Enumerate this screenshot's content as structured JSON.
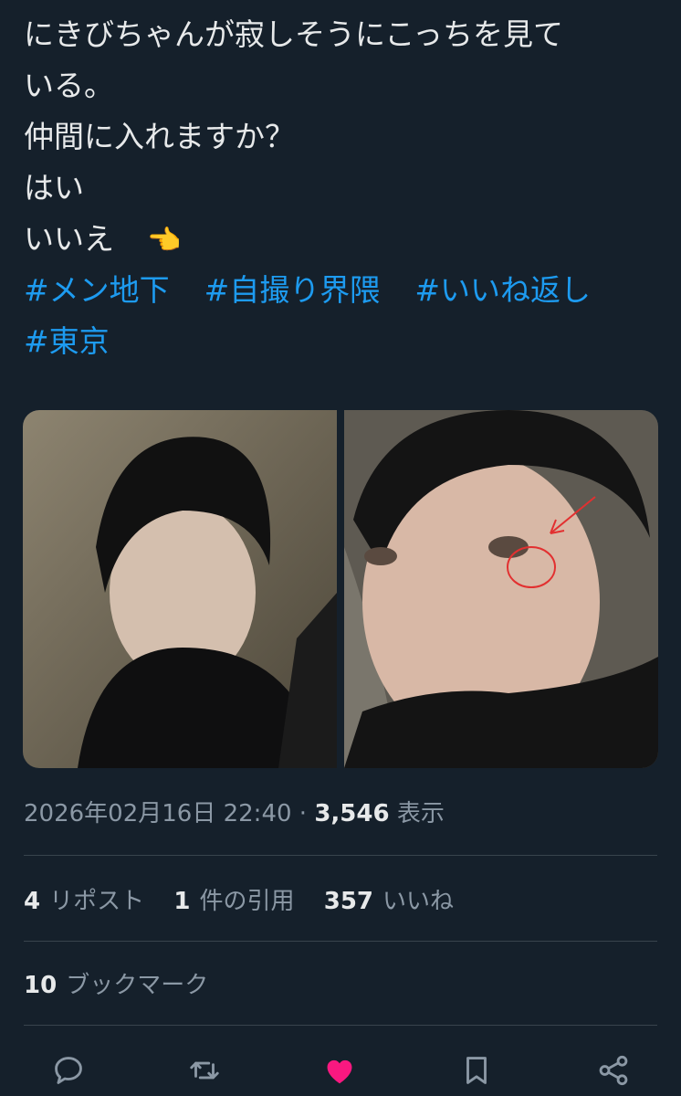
{
  "tweet": {
    "lines": [
      "にきびちゃんが寂しそうにこっちを見て",
      "いる。",
      "仲間に入れますか？",
      "はい",
      "いいえ"
    ],
    "emoji": "👈",
    "hashtags": [
      "#メン地下",
      "#自撮り界隈",
      "#いいね返し",
      "#東京"
    ]
  },
  "meta": {
    "datetime": "2026年02月16日 22:40",
    "separator": "·",
    "views": "3,546",
    "views_label": "表示"
  },
  "stats": {
    "reposts": "4",
    "reposts_label": "リポスト",
    "quotes": "1",
    "quotes_label": "件の引用",
    "likes": "357",
    "likes_label": "いいね"
  },
  "bookmarks": {
    "count": "10",
    "label": "ブックマーク"
  },
  "actions": [
    "reply-icon",
    "repost-icon",
    "like-icon",
    "bookmark-icon",
    "share-icon"
  ],
  "colors": {
    "background": "#15202b",
    "link": "#1d9bf0",
    "like": "#f91880",
    "muted": "#8b98a5"
  }
}
